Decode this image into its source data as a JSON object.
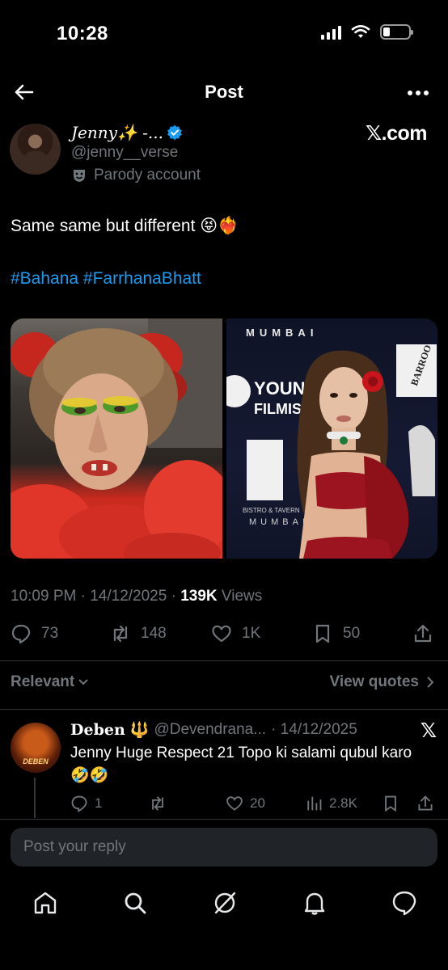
{
  "status_bar": {
    "time": "10:28"
  },
  "header": {
    "title": "Post"
  },
  "author": {
    "display_name": "Jenny✨ -...",
    "handle": "@jenny__verse",
    "parody_label": "Parody account",
    "watermark": "𝕏.com"
  },
  "tweet": {
    "text": "Same same but different 😝❤️‍🔥",
    "hashtags": "#Bahana #FarrhanaBhatt",
    "images": [
      {
        "signage": []
      },
      {
        "signage": [
          "MUMBAI",
          "YOUNG",
          "FILMIST",
          "BARROO",
          "BISTRO & TAVERN",
          "MUMBAI"
        ]
      }
    ]
  },
  "meta": {
    "time": "10:09 PM",
    "date": "14/12/2025",
    "views_count": "139K",
    "views_label": "Views",
    "separator": "·"
  },
  "actions": {
    "replies": "73",
    "reposts": "148",
    "likes": "1K",
    "bookmarks": "50"
  },
  "sort": {
    "relevant": "Relevant",
    "view_quotes": "View quotes"
  },
  "reply": {
    "name": "Deben",
    "emoji": "🔱",
    "handle": "@Devendrana...",
    "date": "· 14/12/2025",
    "x_logo": "𝕏",
    "avatar_text": "DEBEN",
    "text": "Jenny Huge Respect 21 Topo ki salami qubul karo 🤣🤣",
    "replies": "1",
    "reposts": "",
    "likes": "20",
    "views": "2.8K"
  },
  "composer": {
    "placeholder": "Post your reply"
  },
  "colors": {
    "accent": "#1d9bf0",
    "muted": "#71767b",
    "background": "#000000"
  }
}
